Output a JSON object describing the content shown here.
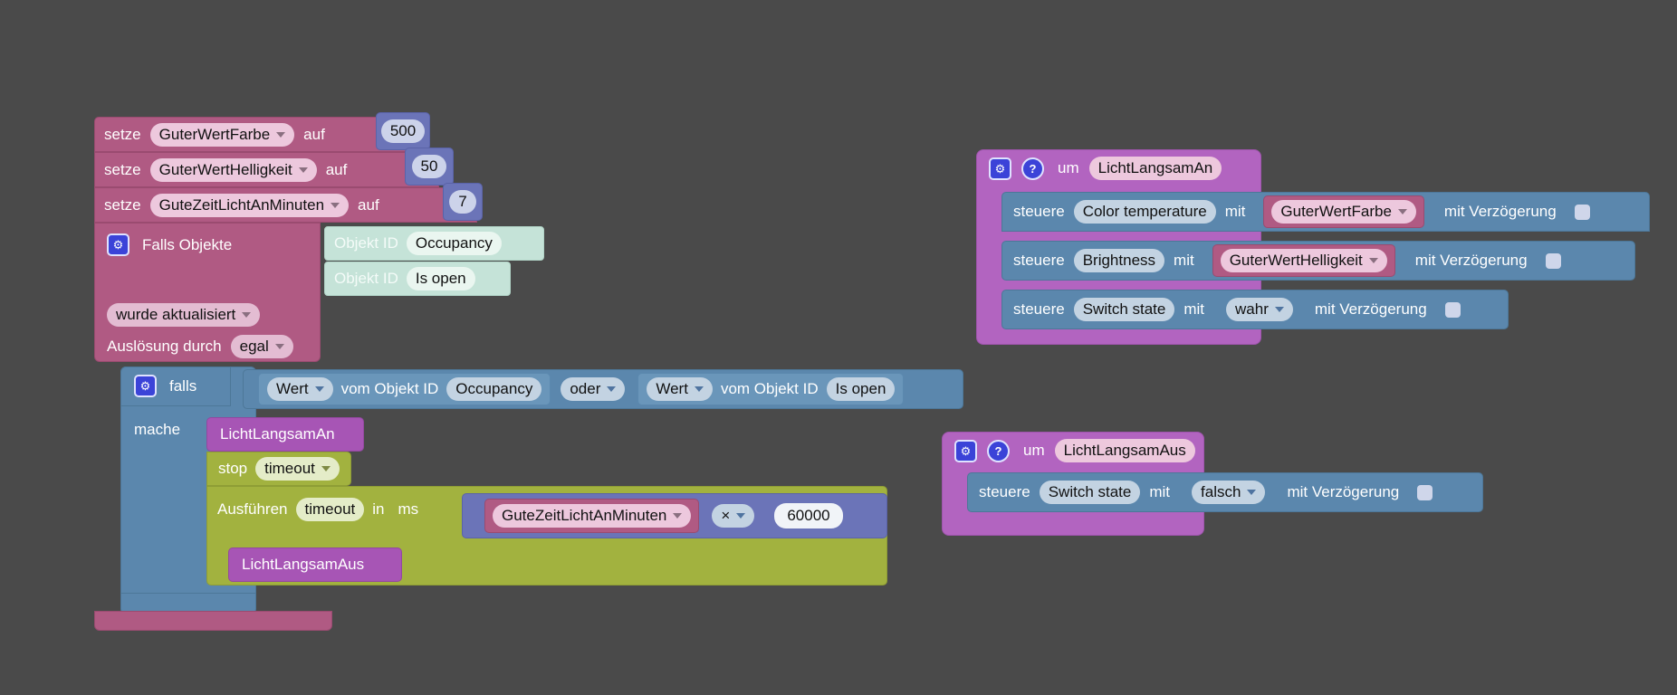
{
  "app": {
    "kind": "blockly-visual-script-editor",
    "background": "#4a4a4a",
    "colors": {
      "variable_block": "#b05a83",
      "number_block": "#6b74b8",
      "control_block": "#5b87ad",
      "object_block": "#c5e3d8",
      "function_block": "#a755b5",
      "function_def_block": "#b264c0",
      "timeout_block": "#a2b23f"
    }
  },
  "variable_sets": [
    {
      "keyword": "setze",
      "variable": "GuterWertFarbe",
      "connector": "auf",
      "value": "500"
    },
    {
      "keyword": "setze",
      "variable": "GuterWertHelligkeit",
      "connector": "auf",
      "value": "50"
    },
    {
      "keyword": "setze",
      "variable": "GuteZeitLichtAnMinuten",
      "connector": "auf",
      "value": "7"
    }
  ],
  "trigger": {
    "gear_icon": "gear-icon",
    "title": "Falls Objekte",
    "objects": [
      {
        "label": "Objekt ID",
        "value": "Occupancy"
      },
      {
        "label": "Objekt ID",
        "value": "Is open"
      }
    ],
    "condition_dropdown": "wurde aktualisiert",
    "source_label": "Auslösung durch",
    "source_dropdown": "egal"
  },
  "if_block": {
    "gear_icon": "gear-icon",
    "keyword": "falls",
    "conditions": [
      {
        "value_dropdown": "Wert",
        "label": "vom Objekt ID",
        "object": "Occupancy"
      },
      {
        "value_dropdown": "Wert",
        "label": "vom Objekt ID",
        "object": "Is open"
      }
    ],
    "operator": "oder",
    "do_label": "mache",
    "body": {
      "call_function": "LichtLangsamAn",
      "stop": {
        "keyword": "stop",
        "target": "timeout"
      },
      "run": {
        "keyword": "Ausführen",
        "target": "timeout",
        "in_label": "in",
        "unit": "ms",
        "expression": {
          "left_variable": "GuteZeitLichtAnMinuten",
          "operator": "×",
          "right_value": "60000"
        },
        "inner_call": "LichtLangsamAus"
      }
    }
  },
  "functions": [
    {
      "gear_icon": "gear-icon",
      "help_icon": "help-icon",
      "keyword": "um",
      "name": "LichtLangsamAn",
      "statements": [
        {
          "keyword": "steuere",
          "target": "Color temperature",
          "with": "mit",
          "value_variable": "GuterWertFarbe",
          "delay_label": "mit Verzögerung"
        },
        {
          "keyword": "steuere",
          "target": "Brightness",
          "with": "mit",
          "value_variable": "GuterWertHelligkeit",
          "delay_label": "mit Verzögerung"
        },
        {
          "keyword": "steuere",
          "target": "Switch state",
          "with": "mit",
          "value_dropdown": "wahr",
          "delay_label": "mit Verzögerung"
        }
      ]
    },
    {
      "gear_icon": "gear-icon",
      "help_icon": "help-icon",
      "keyword": "um",
      "name": "LichtLangsamAus",
      "statements": [
        {
          "keyword": "steuere",
          "target": "Switch state",
          "with": "mit",
          "value_dropdown": "falsch",
          "delay_label": "mit Verzögerung"
        }
      ]
    }
  ]
}
